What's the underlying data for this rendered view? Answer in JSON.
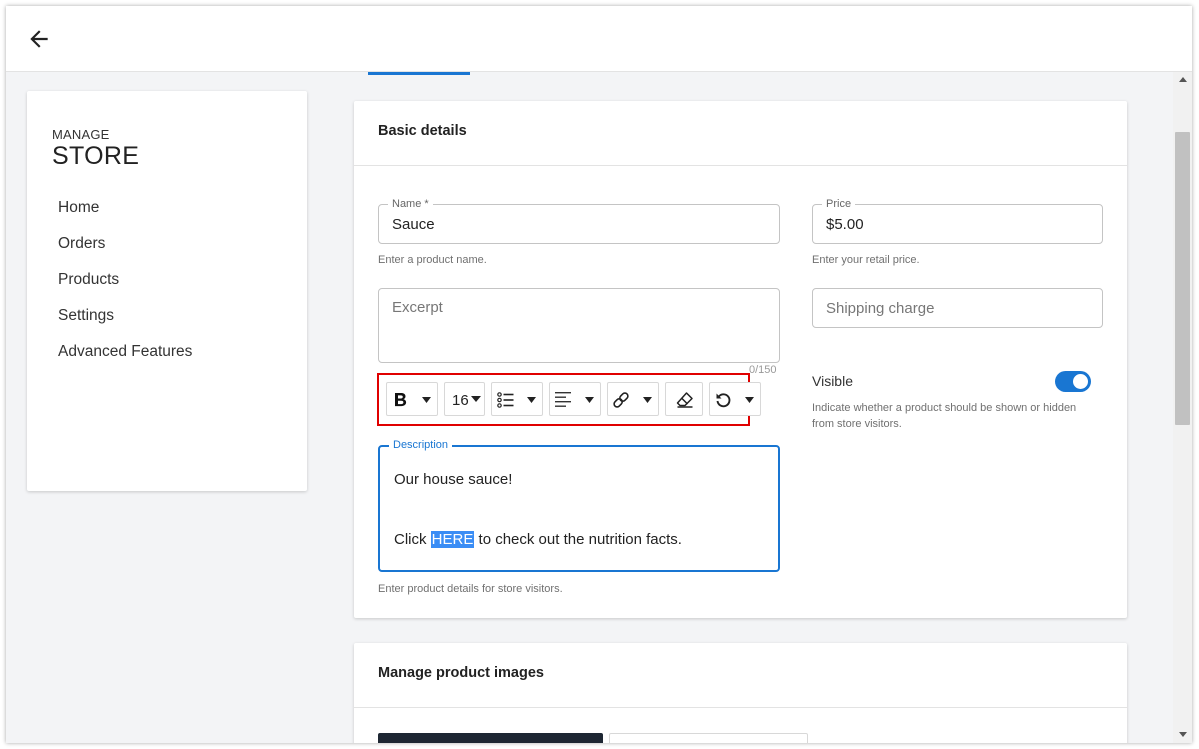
{
  "sidebar": {
    "brand_small": "MANAGE",
    "brand_big": "STORE",
    "items": [
      {
        "label": "Home"
      },
      {
        "label": "Orders"
      },
      {
        "label": "Products"
      },
      {
        "label": "Settings"
      },
      {
        "label": "Advanced Features"
      }
    ]
  },
  "basic_details": {
    "title": "Basic details",
    "name": {
      "label": "Name *",
      "value": "Sauce",
      "helper": "Enter a product name."
    },
    "price": {
      "label": "Price",
      "value": "$5.00",
      "helper": "Enter your retail price."
    },
    "excerpt": {
      "placeholder": "Excerpt",
      "counter": "0/150"
    },
    "shipping": {
      "placeholder": "Shipping charge"
    },
    "toolbar": {
      "font_size": "16"
    },
    "description": {
      "label": "Description",
      "line1": "Our house sauce!",
      "line2_before": "Click ",
      "line2_highlight": "HERE",
      "line2_after": " to check out the nutrition facts.",
      "helper": "Enter product details for store visitors."
    },
    "visible": {
      "label": "Visible",
      "helper": "Indicate whether a product should be shown or hidden from store visitors."
    }
  },
  "images": {
    "title": "Manage product images"
  },
  "colors": {
    "accent": "#1976d2",
    "highlight": "#e00000",
    "selection": "#3a8df5"
  }
}
